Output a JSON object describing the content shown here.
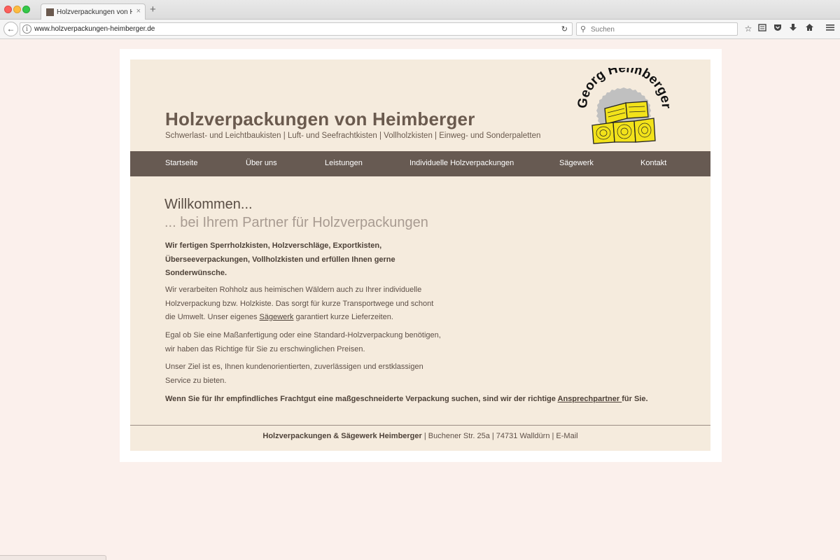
{
  "browser": {
    "tab_title": "Holzverpackungen von Heimberger",
    "tab_close": "×",
    "new_tab": "+",
    "back": "←",
    "info": "i",
    "url": "www.holzverpackungen-heimberger.de",
    "reload": "↻",
    "search_icon": "⚲",
    "search_placeholder": "Suchen",
    "toolbar_icons": [
      "star-icon",
      "reading-list-icon",
      "pocket-icon",
      "download-icon",
      "home-icon",
      "menu-icon"
    ]
  },
  "header": {
    "title": "Holzverpackungen von Heimberger",
    "subtitle": "Schwerlast- und Leichtbaukisten | Luft- und Seefrachtkisten | Vollholzkisten | Einweg- und Sonderpaletten",
    "logo_text": "Georg Heimberger"
  },
  "nav": {
    "items": [
      {
        "label": "Startseite"
      },
      {
        "label": "Über uns"
      },
      {
        "label": "Leistungen"
      },
      {
        "label": "Individuelle Holzverpackungen"
      },
      {
        "label": "Sägewerk"
      },
      {
        "label": "Kontakt"
      }
    ]
  },
  "content": {
    "welcome": "Willkommen...",
    "welcome_sub": "... bei Ihrem Partner für Holzverpackungen",
    "p1": "Wir fertigen Sperrholzkisten, Holzverschläge, Exportkisten, Überseeverpackungen, Vollholzkisten und erfüllen Ihnen gerne Sonderwünsche.",
    "p2_before": "Wir verarbeiten Rohholz aus heimischen Wäldern auch zu Ihrer individuelle Holzverpackung bzw. Holzkiste. Das sorgt für kurze Transportwege und schont die Umwelt. Unser eigenes ",
    "p2_link": "Sägewerk",
    "p2_after": " garantiert kurze Lieferzeiten.",
    "p3": "Egal ob Sie eine Maßanfertigung oder eine Standard-Holzverpackung benötigen, wir haben das Richtige für Sie zu erschwinglichen Preisen.",
    "p4": "Unser Ziel ist es, Ihnen kundenorientierten, zuverlässigen und erstklassigen Service zu bieten.",
    "p5_before": "Wenn Sie für Ihr empfindliches Frachtgut eine maßgeschneiderte Verpackung suchen, sind wir der richtige ",
    "p5_link": "Ansprechpartner ",
    "p5_after": "für Sie."
  },
  "footer": {
    "company": "Holzverpackungen & Sägewerk Heimberger",
    "address": " | Buchener Str. 25a | 74731 Walldürn | E-Mail"
  },
  "colors": {
    "page_bg": "#fbf0ec",
    "site_bg": "#f5ebdd",
    "nav_bg": "#675a52",
    "text": "#5e5048",
    "heading": "#6a5a4e",
    "logo_wood": "#f2e21a"
  }
}
